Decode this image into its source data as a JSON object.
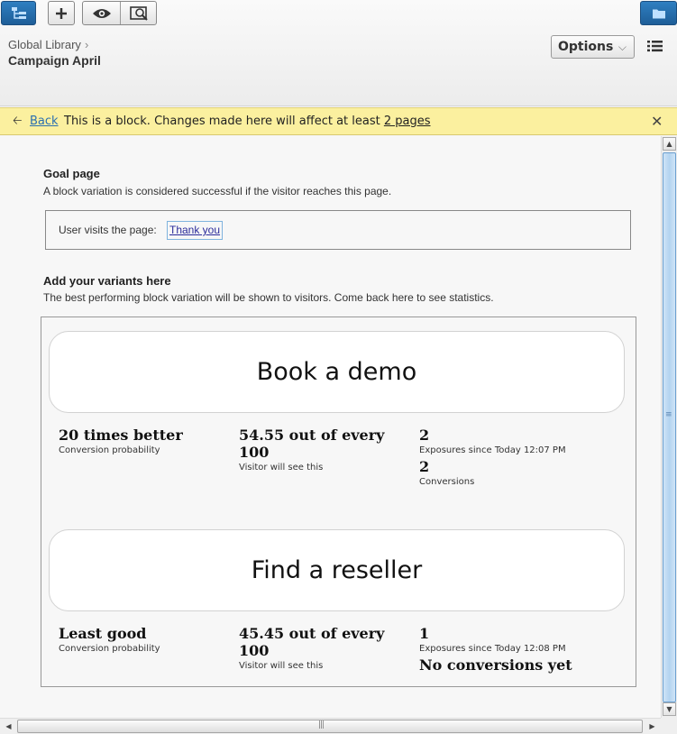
{
  "header": {
    "breadcrumb_parent": "Global Library",
    "page_title": "Campaign April",
    "options_label": "Options"
  },
  "notice": {
    "back_label": "Back",
    "message": "This is a block. Changes made here will affect at least ",
    "pages_link": "2 pages"
  },
  "goal": {
    "title": "Goal page",
    "description": "A block variation is considered successful if the visitor reaches this page.",
    "condition_label": "User visits the page:",
    "page_link": "Thank you"
  },
  "variants_section": {
    "title": "Add your variants here",
    "description": "The best performing block variation will be shown to visitors. Come back here to see statistics."
  },
  "variants": [
    {
      "name": "Book a demo",
      "probability_value": "20 times better",
      "probability_label": "Conversion probability",
      "share_value": "54.55 out of every 100",
      "share_label": "Visitor will see this",
      "exposures_value": "2",
      "exposures_label": "Exposures since Today 12:07 PM",
      "conversions_value": "2",
      "conversions_label": "Conversions"
    },
    {
      "name": "Find a reseller",
      "probability_value": "Least good",
      "probability_label": "Conversion probability",
      "share_value": "45.45 out of every 100",
      "share_label": "Visitor will see this",
      "exposures_value": "1",
      "exposures_label": "Exposures since Today 12:08 PM",
      "conversions_value": "No conversions yet"
    }
  ],
  "icons": {
    "structure": "site-tree-icon",
    "add": "plus-icon",
    "preview": "eye-icon",
    "compare": "compare-preview-icon",
    "assets": "folder-icon",
    "list": "list-icon",
    "back": "arrow-left-icon",
    "close": "close-icon"
  },
  "colors": {
    "accent_blue": "#2f7fc1",
    "notice_bg": "#fbf09f",
    "link": "#2a6fb0"
  }
}
